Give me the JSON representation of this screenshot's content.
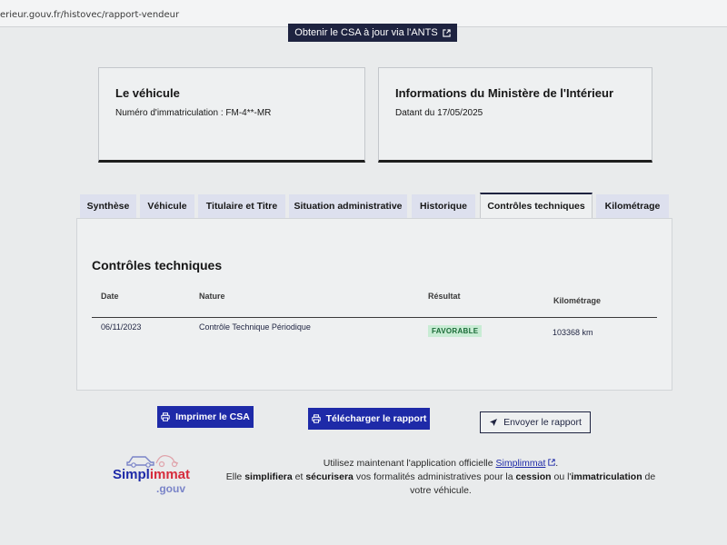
{
  "browser": {
    "url": "erieur.gouv.fr/histovec/rapport-vendeur"
  },
  "top_button": {
    "label": "Obtenir le CSA à jour via l'ANTS",
    "icon": "external-link-icon"
  },
  "vehicle_card": {
    "title": "Le véhicule",
    "plate_text": "Numéro d'immatriculation : FM-4**-MR"
  },
  "ministry_card": {
    "title": "Informations du Ministère de l'Intérieur",
    "date_text": "Datant du 17/05/2025"
  },
  "tabs": [
    {
      "label": "Synthèse",
      "active": false
    },
    {
      "label": "Véhicule",
      "active": false
    },
    {
      "label": "Titulaire et Titre",
      "active": false
    },
    {
      "label": "Situation administrative",
      "active": false
    },
    {
      "label": "Historique",
      "active": false
    },
    {
      "label": "Contrôles techniques",
      "active": true
    },
    {
      "label": "Kilométrage",
      "active": false
    }
  ],
  "controls": {
    "title": "Contrôles techniques",
    "columns": [
      "Date",
      "Nature",
      "Résultat",
      "Kilométrage"
    ],
    "rows": [
      {
        "date": "06/11/2023",
        "nature": "Contrôle Technique Périodique",
        "result": "FAVORABLE",
        "km": "103368 km"
      }
    ]
  },
  "actions": {
    "print_label": "Imprimer le CSA",
    "download_label": "Télécharger le rapport",
    "send_label": "Envoyer le rapport"
  },
  "promo": {
    "logo_simpl": "Simpl",
    "logo_immat": "immat",
    "logo_gouv": ".gouv",
    "line1_before": "Utilisez maintenant l'application officielle",
    "app_link": "Simplimmat",
    "line1_after": ".",
    "line2_a": "Elle",
    "line2_b": "simplifiera",
    "line2_c": "et",
    "line2_d": "sécurisera",
    "line2_e": "vos formalités administratives pour la",
    "line2_f": "cession",
    "line2_g": "ou l'",
    "line2_h": "immatriculation",
    "line2_i": "de votre véhicule."
  },
  "colors": {
    "navy": "#1e2340",
    "primary_blue": "#1e2aa8",
    "success_bg": "#c8ecd4",
    "success_text": "#1a6b37"
  }
}
